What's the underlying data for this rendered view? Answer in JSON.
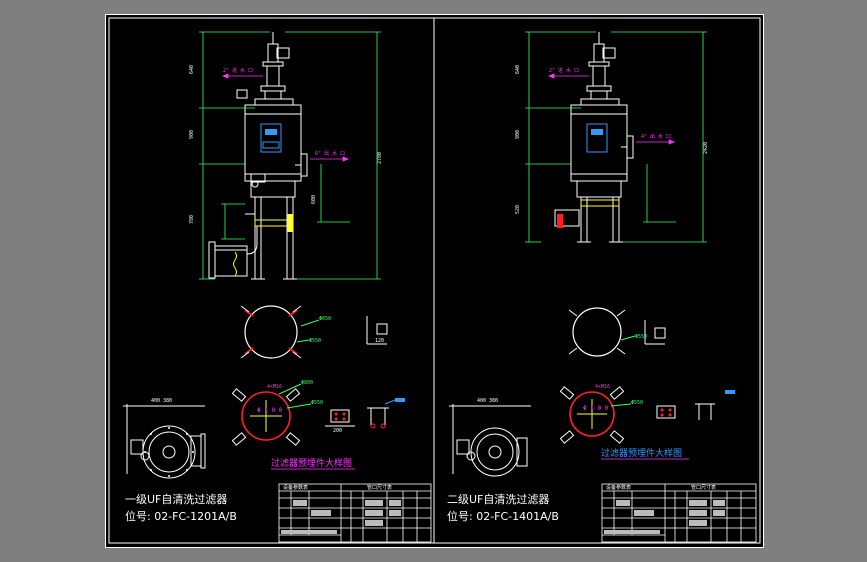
{
  "left_panel": {
    "title": "一级UF自清洗过滤器",
    "tag": "位号: 02-FC-1201A/B",
    "detail_caption": "过滤器预埋件大样图"
  },
  "right_panel": {
    "title": "二级UF自清洗过滤器",
    "tag": "位号: 02-FC-1401A/B",
    "detail_caption": "过滤器预埋件大样图"
  },
  "title_block": {
    "header_left": "设备参数表",
    "header_right": "管口尺寸表"
  },
  "colors": {
    "background": "#000000",
    "frame": "#ffffff",
    "dimension": "#33ff66",
    "annotation": "#ff33ff",
    "equipment_red": "#ff2020",
    "detail_yellow": "#ffff33",
    "nozzle_blue": "#3399ff"
  }
}
